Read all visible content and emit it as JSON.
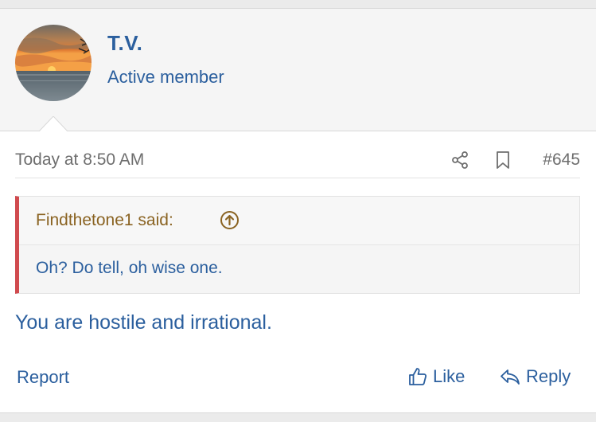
{
  "user": {
    "name": "T.V.",
    "title": "Active member",
    "avatar_icon": "sunset-over-sea-avatar"
  },
  "post": {
    "timestamp": "Today at 8:50 AM",
    "number": "#645",
    "share_icon": "share-icon",
    "bookmark_icon": "bookmark-icon",
    "quote": {
      "author_label": "Findthetone1 said:",
      "jump_icon": "arrow-up-circle-icon",
      "text": "Oh? Do tell, oh wise one."
    },
    "body": "You are hostile and irrational."
  },
  "actions": {
    "report": "Report",
    "like": "Like",
    "reply": "Reply"
  },
  "colors": {
    "link": "#2b5f9e",
    "quote_author": "#8a6322",
    "quote_border": "#d04a4e",
    "meta_text": "#6e6e6e"
  }
}
